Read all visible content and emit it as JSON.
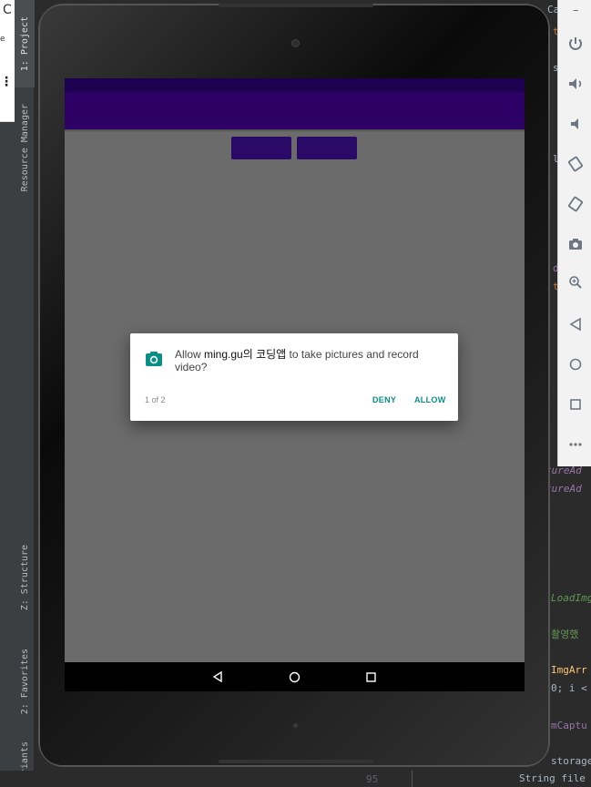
{
  "ide": {
    "left_tabs": [
      {
        "label": "1: Project"
      },
      {
        "label": "Resource Manager"
      },
      {
        "label": "Z: Structure"
      },
      {
        "label": "2: Favorites"
      },
      {
        "label": "Variants"
      }
    ],
    "left_fragments": {
      "c": "C",
      "e": "e"
    },
    "right_fragments": [
      "Ca",
      "tureAd",
      "tureAd",
      "LoadImg",
      "촬영했",
      "ImgArr",
      "0; i <",
      "mCaptu",
      "storage"
    ],
    "bottom_line_number": "95",
    "bottom_code": "String file"
  },
  "emulator_panel": {
    "buttons": [
      "power-icon",
      "volume-up-icon",
      "volume-down-icon",
      "rotate-left-icon",
      "rotate-right-icon",
      "screenshot-icon",
      "zoom-icon",
      "back-icon",
      "home-icon",
      "overview-icon",
      "more-icon"
    ]
  },
  "dialog": {
    "text_before": "Allow ",
    "app_name": "ming.gu의 코딩앱",
    "text_after": " to take pictures and record video?",
    "counter": "1 of 2",
    "deny_label": "DENY",
    "allow_label": "ALLOW",
    "accent": "#0a8f87"
  },
  "colors": {
    "status_bar": "#1e0050",
    "app_bar": "#2c0065",
    "screen_bg": "#6b6b6b"
  }
}
